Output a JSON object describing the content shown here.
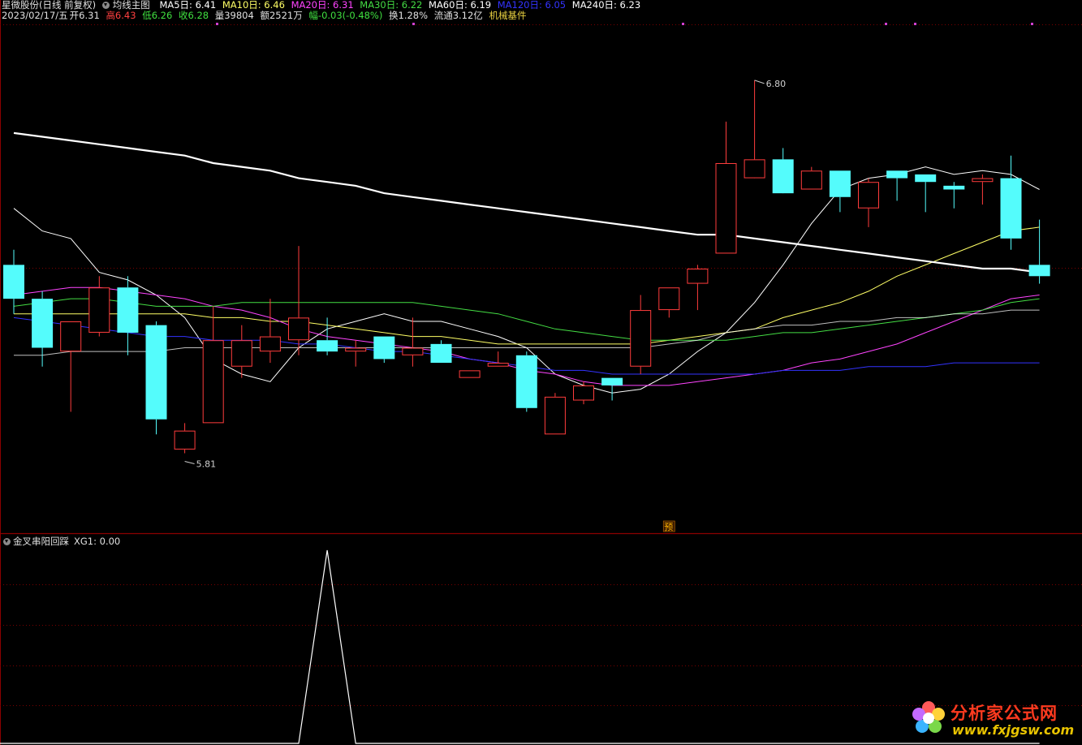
{
  "header": {
    "stock_title": "星微股份(日线 前复权)",
    "indicator_name": "均线主图",
    "ma": [
      {
        "label": "MA5日: 6.41",
        "color": "#ffffff"
      },
      {
        "label": "MA10日: 6.46",
        "color": "#ffff66"
      },
      {
        "label": "MA20日: 6.31",
        "color": "#ff44ff"
      },
      {
        "label": "MA30日: 6.22",
        "color": "#44dd44"
      },
      {
        "label": "MA60日: 6.19",
        "color": "#ffffff"
      },
      {
        "label": "MA120日: 6.05",
        "color": "#3333ff"
      },
      {
        "label": "MA240日: 6.23",
        "color": "#ffffff"
      }
    ],
    "quote": {
      "date": "2023/02/17/五",
      "open": "开6.31",
      "high": "高6.43",
      "low": "低6.26",
      "close": "收6.28",
      "volume": "量39804",
      "amount": "额2521万",
      "change": "幅-0.03(-0.48%)",
      "turnover": "换1.28%",
      "float_cap": "流通3.12亿",
      "industry": "机械基件"
    }
  },
  "chart_data": [
    {
      "type": "candlestick",
      "panel": "main",
      "price_range": [
        5.6,
        7.0
      ],
      "annotations": {
        "high_marker": "6.80",
        "low_marker": "5.81",
        "forecast_tag": "预"
      },
      "candles": [
        {
          "o": 6.31,
          "h": 6.35,
          "l": 6.18,
          "c": 6.22
        },
        {
          "o": 6.22,
          "h": 6.24,
          "l": 6.04,
          "c": 6.09
        },
        {
          "o": 6.08,
          "h": 6.15,
          "l": 5.92,
          "c": 6.16
        },
        {
          "o": 6.13,
          "h": 6.28,
          "l": 6.12,
          "c": 6.25
        },
        {
          "o": 6.25,
          "h": 6.28,
          "l": 6.07,
          "c": 6.13
        },
        {
          "o": 6.15,
          "h": 6.16,
          "l": 5.86,
          "c": 5.9
        },
        {
          "o": 5.82,
          "h": 5.89,
          "l": 5.81,
          "c": 5.87
        },
        {
          "o": 5.89,
          "h": 6.2,
          "l": 5.89,
          "c": 6.11
        },
        {
          "o": 6.04,
          "h": 6.15,
          "l": 6.01,
          "c": 6.11
        },
        {
          "o": 6.08,
          "h": 6.22,
          "l": 6.05,
          "c": 6.12
        },
        {
          "o": 6.11,
          "h": 6.36,
          "l": 6.07,
          "c": 6.17
        },
        {
          "o": 6.11,
          "h": 6.17,
          "l": 6.07,
          "c": 6.08
        },
        {
          "o": 6.08,
          "h": 6.11,
          "l": 6.04,
          "c": 6.09
        },
        {
          "o": 6.12,
          "h": 6.12,
          "l": 6.05,
          "c": 6.06
        },
        {
          "o": 6.07,
          "h": 6.17,
          "l": 6.04,
          "c": 6.09
        },
        {
          "o": 6.1,
          "h": 6.11,
          "l": 6.05,
          "c": 6.05
        },
        {
          "o": 6.01,
          "h": 6.03,
          "l": 6.01,
          "c": 6.03
        },
        {
          "o": 6.04,
          "h": 6.08,
          "l": 6.04,
          "c": 6.05
        },
        {
          "o": 6.07,
          "h": 6.08,
          "l": 5.92,
          "c": 5.93
        },
        {
          "o": 5.86,
          "h": 5.97,
          "l": 5.86,
          "c": 5.96
        },
        {
          "o": 5.95,
          "h": 6.0,
          "l": 5.94,
          "c": 5.99
        },
        {
          "o": 6.01,
          "h": 6.01,
          "l": 5.95,
          "c": 5.99
        },
        {
          "o": 6.04,
          "h": 6.23,
          "l": 6.02,
          "c": 6.19
        },
        {
          "o": 6.19,
          "h": 6.25,
          "l": 6.17,
          "c": 6.25
        },
        {
          "o": 6.26,
          "h": 6.31,
          "l": 6.19,
          "c": 6.3
        },
        {
          "o": 6.34,
          "h": 6.69,
          "l": 6.34,
          "c": 6.58
        },
        {
          "o": 6.54,
          "h": 6.8,
          "l": 6.55,
          "c": 6.59
        },
        {
          "o": 6.59,
          "h": 6.62,
          "l": 6.53,
          "c": 6.5
        },
        {
          "o": 6.51,
          "h": 6.57,
          "l": 6.51,
          "c": 6.56
        },
        {
          "o": 6.56,
          "h": 6.56,
          "l": 6.45,
          "c": 6.49
        },
        {
          "o": 6.46,
          "h": 6.54,
          "l": 6.41,
          "c": 6.53
        },
        {
          "o": 6.56,
          "h": 6.56,
          "l": 6.48,
          "c": 6.54
        },
        {
          "o": 6.55,
          "h": 6.55,
          "l": 6.45,
          "c": 6.53
        },
        {
          "o": 6.52,
          "h": 6.53,
          "l": 6.46,
          "c": 6.51
        },
        {
          "o": 6.53,
          "h": 6.55,
          "l": 6.47,
          "c": 6.54
        },
        {
          "o": 6.54,
          "h": 6.6,
          "l": 6.35,
          "c": 6.38
        },
        {
          "o": 6.31,
          "h": 6.43,
          "l": 6.26,
          "c": 6.28
        }
      ],
      "ma_lines": [
        {
          "name": "MA5",
          "color": "#ffffff",
          "values": [
            6.46,
            6.4,
            6.38,
            6.29,
            6.27,
            6.23,
            6.17,
            6.06,
            6.02,
            6.0,
            6.09,
            6.14,
            6.16,
            6.18,
            6.16,
            6.16,
            6.14,
            6.12,
            6.09,
            6.02,
            5.99,
            5.97,
            5.98,
            6.02,
            6.08,
            6.13,
            6.21,
            6.31,
            6.42,
            6.51,
            6.54,
            6.55,
            6.57,
            6.55,
            6.56,
            6.55,
            6.51
          ]
        },
        {
          "name": "MA10",
          "color": "#ffff66",
          "values": [
            6.18,
            6.18,
            6.18,
            6.18,
            6.18,
            6.18,
            6.18,
            6.17,
            6.17,
            6.16,
            6.16,
            6.15,
            6.14,
            6.13,
            6.12,
            6.12,
            6.11,
            6.1,
            6.1,
            6.1,
            6.1,
            6.1,
            6.1,
            6.11,
            6.12,
            6.13,
            6.14,
            6.17,
            6.19,
            6.21,
            6.24,
            6.28,
            6.31,
            6.34,
            6.37,
            6.4,
            6.41
          ]
        },
        {
          "name": "MA20",
          "color": "#ff44ff",
          "values": [
            6.23,
            6.24,
            6.25,
            6.25,
            6.24,
            6.23,
            6.22,
            6.2,
            6.19,
            6.17,
            6.14,
            6.12,
            6.11,
            6.1,
            6.09,
            6.08,
            6.06,
            6.05,
            6.03,
            6.02,
            6.0,
            5.99,
            5.99,
            5.99,
            6.0,
            6.01,
            6.02,
            6.03,
            6.05,
            6.06,
            6.08,
            6.1,
            6.13,
            6.16,
            6.19,
            6.22,
            6.23
          ]
        },
        {
          "name": "MA30",
          "color": "#44dd44",
          "values": [
            6.2,
            6.21,
            6.22,
            6.22,
            6.21,
            6.2,
            6.2,
            6.2,
            6.21,
            6.21,
            6.21,
            6.21,
            6.21,
            6.21,
            6.21,
            6.2,
            6.19,
            6.18,
            6.16,
            6.14,
            6.13,
            6.12,
            6.11,
            6.11,
            6.11,
            6.11,
            6.12,
            6.13,
            6.13,
            6.14,
            6.15,
            6.16,
            6.17,
            6.18,
            6.19,
            6.21,
            6.22
          ]
        },
        {
          "name": "MA60",
          "color": "#ffffff",
          "values": [
            6.07,
            6.07,
            6.08,
            6.08,
            6.08,
            6.08,
            6.09,
            6.09,
            6.09,
            6.09,
            6.09,
            6.09,
            6.09,
            6.09,
            6.09,
            6.09,
            6.09,
            6.09,
            6.09,
            6.09,
            6.09,
            6.09,
            6.09,
            6.1,
            6.11,
            6.13,
            6.14,
            6.15,
            6.15,
            6.16,
            6.16,
            6.17,
            6.17,
            6.18,
            6.18,
            6.19,
            6.19
          ]
        },
        {
          "name": "MA120",
          "color": "#3333ff",
          "values": [
            6.17,
            6.16,
            6.15,
            6.14,
            6.13,
            6.12,
            6.12,
            6.11,
            6.11,
            6.11,
            6.1,
            6.1,
            6.09,
            6.08,
            6.08,
            6.07,
            6.06,
            6.05,
            6.04,
            6.03,
            6.03,
            6.02,
            6.02,
            6.02,
            6.02,
            6.02,
            6.02,
            6.03,
            6.03,
            6.03,
            6.04,
            6.04,
            6.04,
            6.05,
            6.05,
            6.05,
            6.05
          ]
        },
        {
          "name": "MA240",
          "color": "#ffffff",
          "values": [
            6.66,
            6.65,
            6.64,
            6.63,
            6.62,
            6.61,
            6.6,
            6.58,
            6.57,
            6.56,
            6.54,
            6.53,
            6.52,
            6.5,
            6.49,
            6.48,
            6.47,
            6.46,
            6.45,
            6.44,
            6.43,
            6.42,
            6.41,
            6.4,
            6.39,
            6.39,
            6.38,
            6.37,
            6.36,
            6.35,
            6.34,
            6.33,
            6.32,
            6.31,
            6.3,
            6.3,
            6.29
          ]
        }
      ]
    },
    {
      "type": "line",
      "panel": "indicator",
      "title": "金叉串阳回踩 XG1: 0.00",
      "series": [
        {
          "name": "XG1",
          "values": [
            0,
            0,
            0,
            0,
            0,
            0,
            0,
            0,
            0,
            0,
            0,
            1,
            0,
            0,
            0,
            0,
            0,
            0,
            0,
            0,
            0,
            0,
            0,
            0,
            0,
            0,
            0,
            0,
            0,
            0,
            0,
            0,
            0,
            0,
            0,
            0,
            0
          ]
        }
      ],
      "ylim": [
        0,
        1
      ]
    }
  ],
  "indicator": {
    "name": "金叉串阳回踩",
    "value_label": "XG1: 0.00"
  },
  "colors": {
    "up": "#ff3c3c",
    "down": "#54fcfc",
    "grid": "#7a0000",
    "border": "#8b0000"
  },
  "watermark": {
    "cn": "分析家公式网",
    "url": "www.fxjgsw.com"
  }
}
